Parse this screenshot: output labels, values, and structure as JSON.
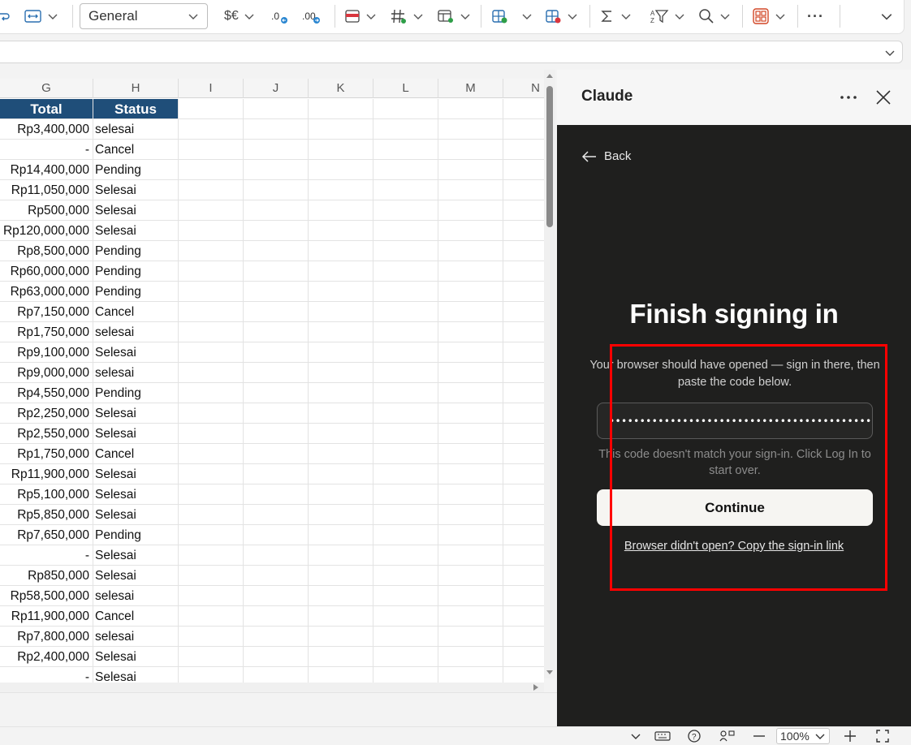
{
  "ribbon": {
    "number_format": "General",
    "currency_label": "$€",
    "more_label": "···"
  },
  "sheet": {
    "columns": [
      "G",
      "H",
      "I",
      "J",
      "K",
      "L",
      "M",
      "N"
    ],
    "header": {
      "total": "Total",
      "status": "Status"
    },
    "rows": [
      [
        "Rp3,400,000",
        "selesai"
      ],
      [
        "-",
        "Cancel"
      ],
      [
        "Rp14,400,000",
        "Pending"
      ],
      [
        "Rp11,050,000",
        "Selesai"
      ],
      [
        "Rp500,000",
        "Selesai"
      ],
      [
        "Rp120,000,000",
        "Selesai"
      ],
      [
        "Rp8,500,000",
        "Pending"
      ],
      [
        "Rp60,000,000",
        "Pending"
      ],
      [
        "Rp63,000,000",
        "Pending"
      ],
      [
        "Rp7,150,000",
        "Cancel"
      ],
      [
        "Rp1,750,000",
        "selesai"
      ],
      [
        "Rp9,100,000",
        "Selesai"
      ],
      [
        "Rp9,000,000",
        "selesai"
      ],
      [
        "Rp4,550,000",
        "Pending"
      ],
      [
        "Rp2,250,000",
        "Selesai"
      ],
      [
        "Rp2,550,000",
        "Selesai"
      ],
      [
        "Rp1,750,000",
        "Cancel"
      ],
      [
        "Rp11,900,000",
        "Selesai"
      ],
      [
        "Rp5,100,000",
        "Selesai"
      ],
      [
        "Rp5,850,000",
        "Selesai"
      ],
      [
        "Rp7,650,000",
        "Pending"
      ],
      [
        "-",
        "Selesai"
      ],
      [
        "Rp850,000",
        "Selesai"
      ],
      [
        "Rp58,500,000",
        "selesai"
      ],
      [
        "Rp11,900,000",
        "Cancel"
      ],
      [
        "Rp7,800,000",
        "selesai"
      ],
      [
        "Rp2,400,000",
        "Selesai"
      ],
      [
        "-",
        "Selesai"
      ]
    ]
  },
  "status_bar": {
    "zoom": "100%"
  },
  "panel": {
    "title": "Claude",
    "back_label": "Back",
    "heading": "Finish signing in",
    "subtitle": "Your browser should have opened — sign in there, then paste the code below.",
    "code_value": "•••••••••••••••••••••••••••••••••••••••••••••",
    "error": "This code doesn't match your sign-in. Click Log In to start over.",
    "continue_label": "Continue",
    "link_label": "Browser didn't open? Copy the sign-in link"
  },
  "colors": {
    "header_fill": "#1f4e79",
    "panel_bg": "#1f1f1e",
    "highlight": "#ff0000"
  }
}
